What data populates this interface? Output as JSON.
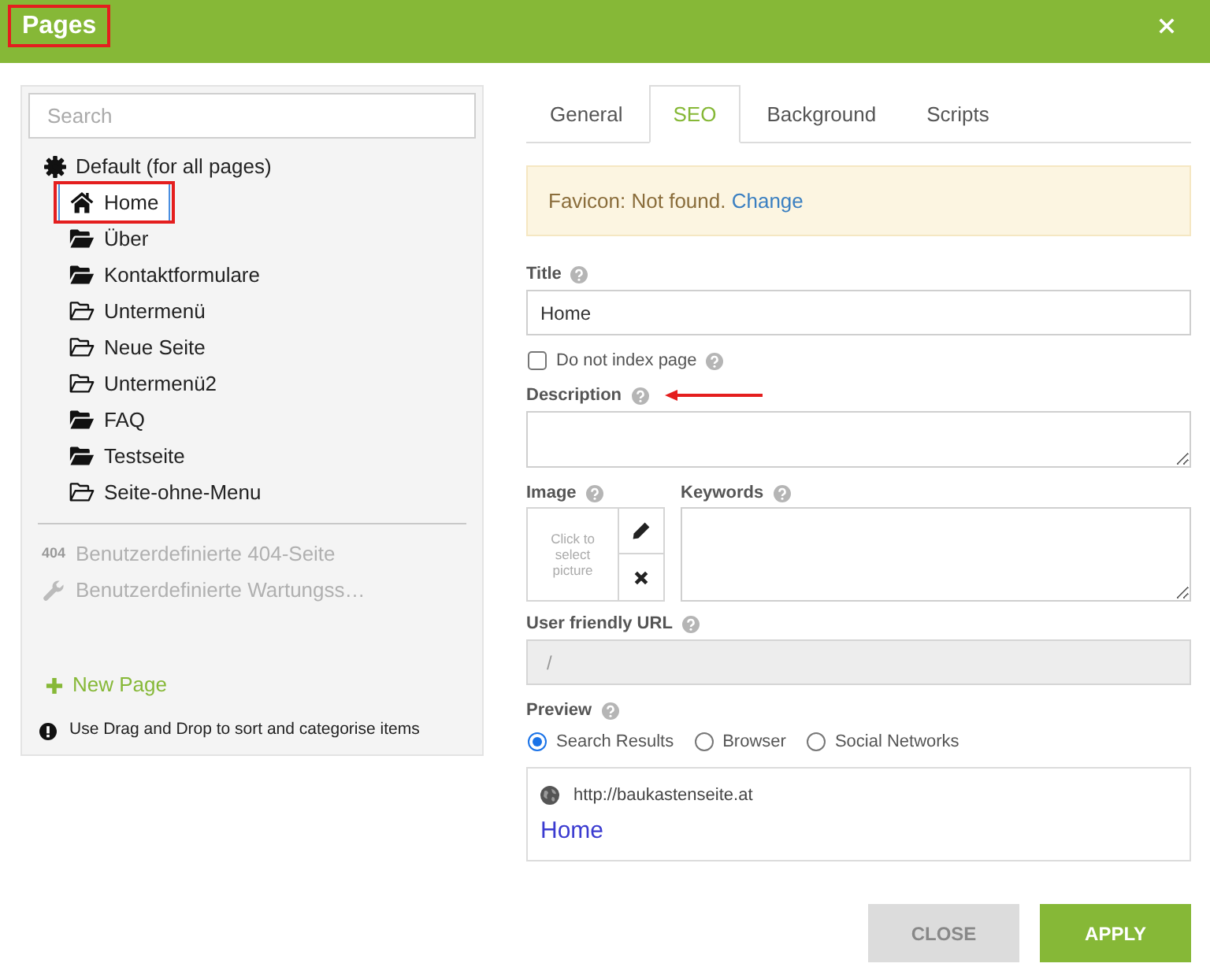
{
  "dialog": {
    "title": "Pages",
    "title_highlighted": true
  },
  "sidebar": {
    "search": {
      "placeholder": "Search"
    },
    "tree": [
      {
        "kind": "gear",
        "label": "Default (for all pages)",
        "selected": false,
        "highlighted": false,
        "children": [
          {
            "kind": "home",
            "label": "Home",
            "selected": true,
            "highlighted": true
          },
          {
            "kind": "filled",
            "label": "Über",
            "selected": false,
            "highlighted": false
          },
          {
            "kind": "filled",
            "label": "Kontaktformulare",
            "selected": false,
            "highlighted": false
          },
          {
            "kind": "outline",
            "label": "Untermenü",
            "selected": false,
            "highlighted": false
          },
          {
            "kind": "outline",
            "label": "Neue Seite",
            "selected": false,
            "highlighted": false
          },
          {
            "kind": "outline",
            "label": "Untermenü2",
            "selected": false,
            "highlighted": false
          },
          {
            "kind": "filled",
            "label": "FAQ",
            "selected": false,
            "highlighted": false
          },
          {
            "kind": "filled",
            "label": "Testseite",
            "selected": false,
            "highlighted": false
          },
          {
            "kind": "outline",
            "label": "Seite-ohne-Menu",
            "selected": false,
            "highlighted": false
          }
        ]
      }
    ],
    "special_pages": [
      {
        "kind": "badge",
        "badge": "404",
        "label": "Benutzerdefinierte 404-Seite",
        "disabled": true
      },
      {
        "kind": "wrench",
        "label": "Benutzerdefinierte Wartungss…",
        "disabled": true
      }
    ],
    "new_page": "New Page",
    "hint": "Use Drag and Drop to sort and categorise items"
  },
  "tabs": [
    {
      "label": "General",
      "selected": false
    },
    {
      "label": "SEO",
      "selected": true
    },
    {
      "label": "Background",
      "selected": false
    },
    {
      "label": "Scripts",
      "selected": false
    }
  ],
  "alert": {
    "text": "Favicon: Not found.",
    "link": "Change"
  },
  "form": {
    "title": {
      "label": "Title",
      "value": "Home"
    },
    "noindex": {
      "label": "Do not index page",
      "checked": false
    },
    "description": {
      "label": "Description",
      "pointed_at": true
    },
    "image": {
      "label": "Image",
      "hint": "Click to select picture"
    },
    "keywords": {
      "label": "Keywords"
    },
    "url": {
      "label": "User friendly URL",
      "value": "/",
      "disabled": true
    },
    "preview": {
      "label": "Preview",
      "options": [
        {
          "label": "Search Results",
          "selected": true
        },
        {
          "label": "Browser",
          "selected": false
        },
        {
          "label": "Social Networks",
          "selected": false
        }
      ],
      "url": "http://baukastenseite.at",
      "page_title": "Home"
    }
  },
  "buttons": [
    {
      "label": "CLOSE",
      "kind": "secondary"
    },
    {
      "label": "APPLY",
      "kind": "primary"
    }
  ]
}
